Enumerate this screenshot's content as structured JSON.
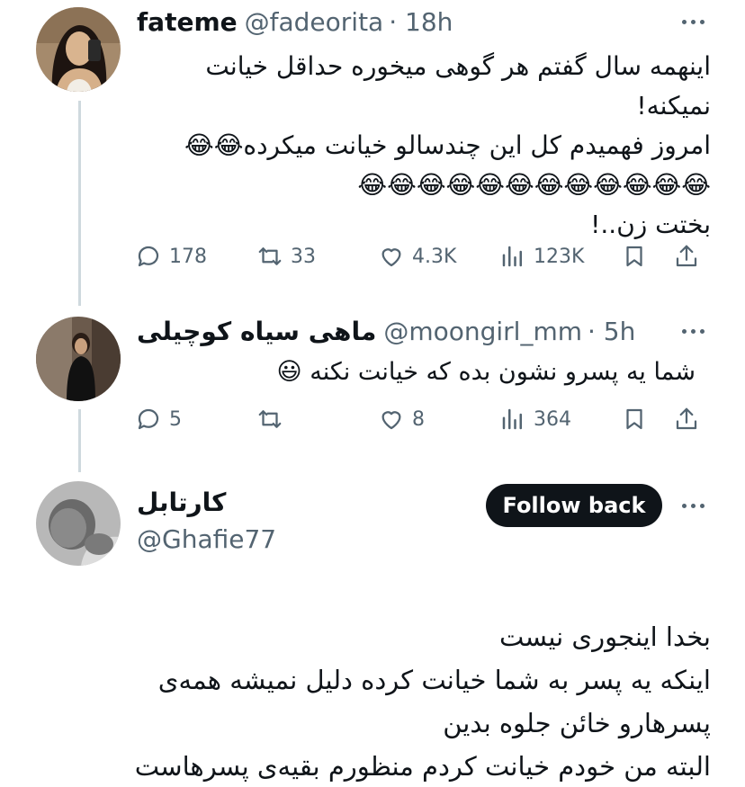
{
  "colors": {
    "text": "#0f1419",
    "muted": "#536471",
    "thread_line": "#cfd9de",
    "button_bg": "#0f1419",
    "button_text": "#ffffff"
  },
  "tweets": [
    {
      "name": "fateme",
      "handle": "@fadeorita",
      "time": "· 18h",
      "lines": [
        "اینهمه سال گفتم هر گوهی میخوره حداقل خیانت",
        "نمیکنه!",
        "امروز فهمیدم کل این چندسالو خیانت میکرده😂😂",
        "😂😂😂😂😂😂😂😂😂😂😂😂",
        "بختت زن..!"
      ],
      "stats": {
        "replies": "178",
        "reposts": "33",
        "likes": "4.3K",
        "views": "123K"
      }
    },
    {
      "name": "ماهی سیاه کوچیلی",
      "handle": "@moongirl_mm",
      "time": "· 5h",
      "lines": [
        "شما یه پسرو نشون بده که خیانت نکنه 😃"
      ],
      "stats": {
        "replies": "5",
        "reposts": "",
        "likes": "8",
        "views": "364"
      }
    },
    {
      "name": "کارتابل",
      "handle": "@Ghafie77",
      "follow_label": "Follow back",
      "lines": [
        "بخدا اینجوری نیست",
        "اینکه یه پسر به شما خیانت کرده دلیل نمیشه همه‌ی",
        "پسرهارو خائن جلوه بدین",
        "البته من خودم خیانت کردم منظورم بقیه‌ی پسرهاست"
      ]
    }
  ],
  "icons": [
    "reply-icon",
    "repost-icon",
    "like-icon",
    "views-icon",
    "bookmark-icon",
    "share-icon",
    "more-icon"
  ]
}
